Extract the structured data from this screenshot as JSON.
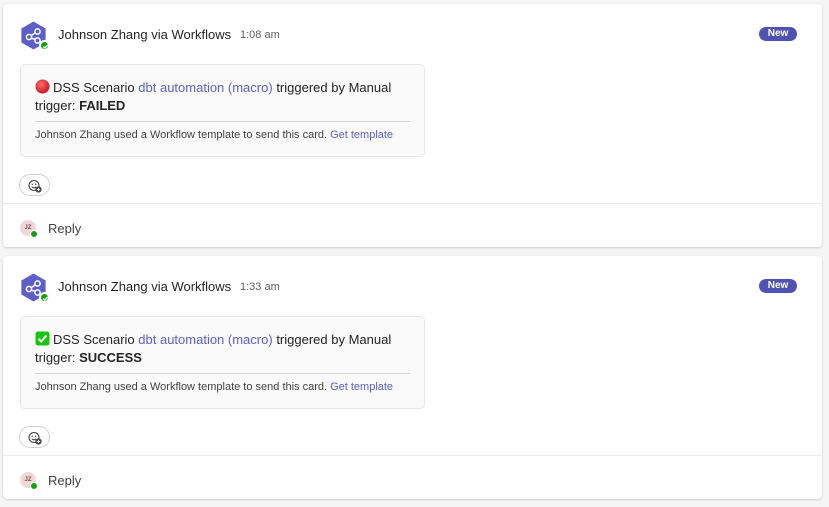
{
  "posts": [
    {
      "sender": "Johnson Zhang via Workflows",
      "time": "1:08 am",
      "badge": "New",
      "card": {
        "status_icon": "red-circle-icon",
        "prefix": "DSS Scenario",
        "link_text": "dbt automation (macro)",
        "middle": "triggered by Manual trigger:",
        "status": "FAILED",
        "footer_text": "Johnson Zhang used a Workflow template to send this card.",
        "footer_link": "Get template"
      },
      "reply_avatar": "JZ",
      "reply_label": "Reply"
    },
    {
      "sender": "Johnson Zhang via Workflows",
      "time": "1:33 am",
      "badge": "New",
      "card": {
        "status_icon": "green-check-icon",
        "prefix": "DSS Scenario",
        "link_text": "dbt automation (macro)",
        "middle": "triggered by Manual trigger:",
        "status": "SUCCESS",
        "footer_text": "Johnson Zhang used a Workflow template to send this card.",
        "footer_link": "Get template"
      },
      "reply_avatar": "JZ",
      "reply_label": "Reply"
    }
  ],
  "colors": {
    "accent": "#5b5fc7",
    "badge": "#4f52b2",
    "workflow_avatar": "#5b5fc7",
    "presence": "#13a10e",
    "failed": "#d13438",
    "success": "#16c60c"
  }
}
